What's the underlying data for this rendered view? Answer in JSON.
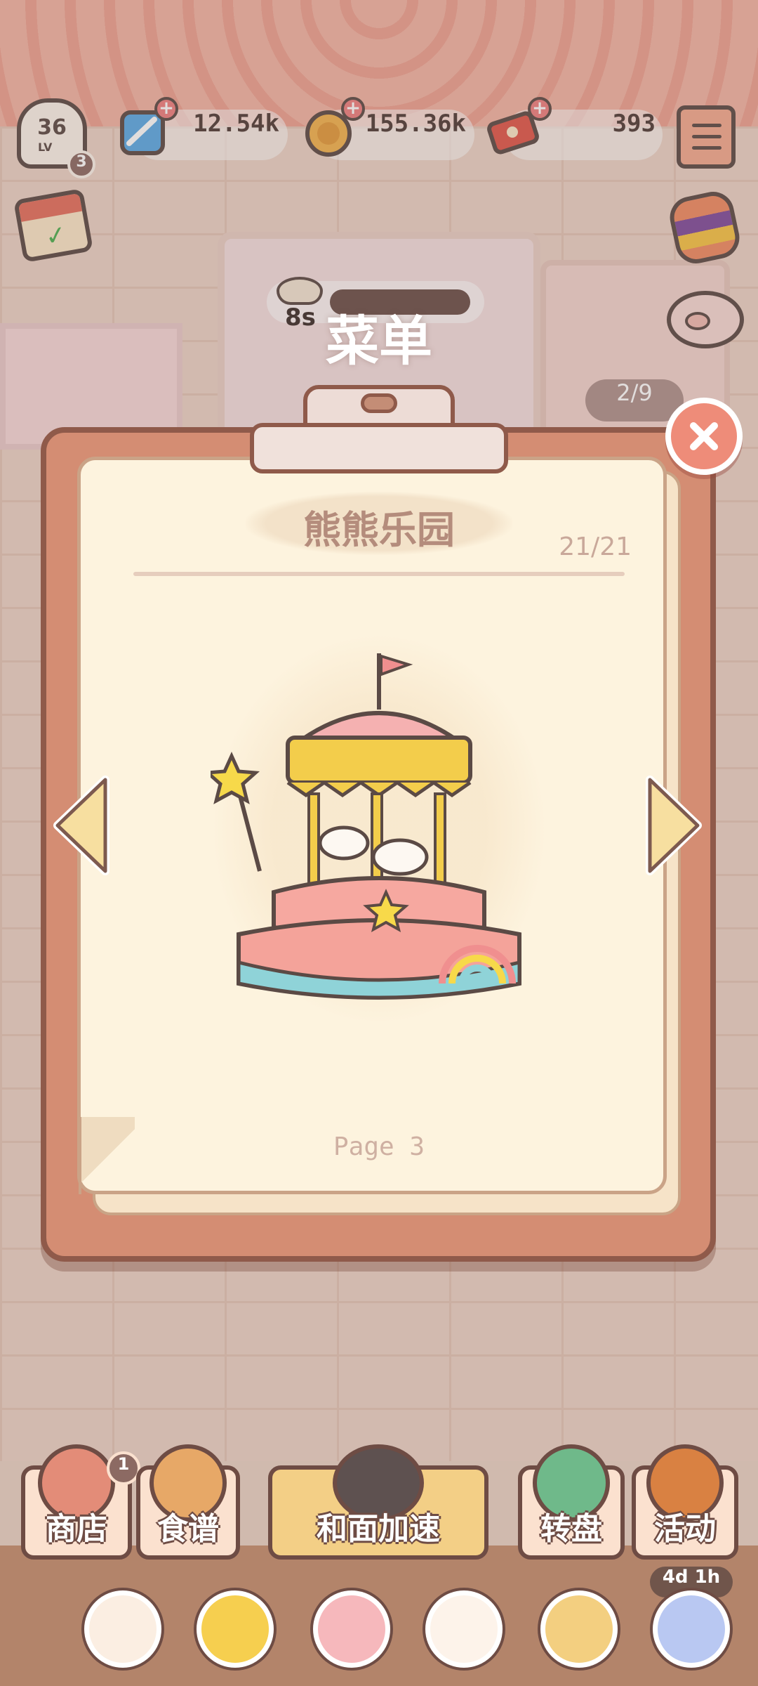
{
  "hud": {
    "level": "36",
    "level_label": "LV",
    "level_sub": "3",
    "gems": "12.54k",
    "coins": "155.36k",
    "tickets": "393",
    "timer": "8s",
    "queue": "2/9"
  },
  "dialog": {
    "title": "菜单",
    "heading": "熊熊乐园",
    "count": "21/21",
    "page": "Page 3",
    "dish_icon": "carousel-cake-icon"
  },
  "bottom_nav": {
    "shop": "商店",
    "shop_badge": "1",
    "recipes": "食谱",
    "speed": "和面加速",
    "wheel": "转盘",
    "event": "活动",
    "event_timer": "4d 1h"
  },
  "colors": {
    "accent": "#ee8c79",
    "clipboard": "#d48d73",
    "paper": "#fdf3de",
    "outline": "#6e4c44"
  }
}
